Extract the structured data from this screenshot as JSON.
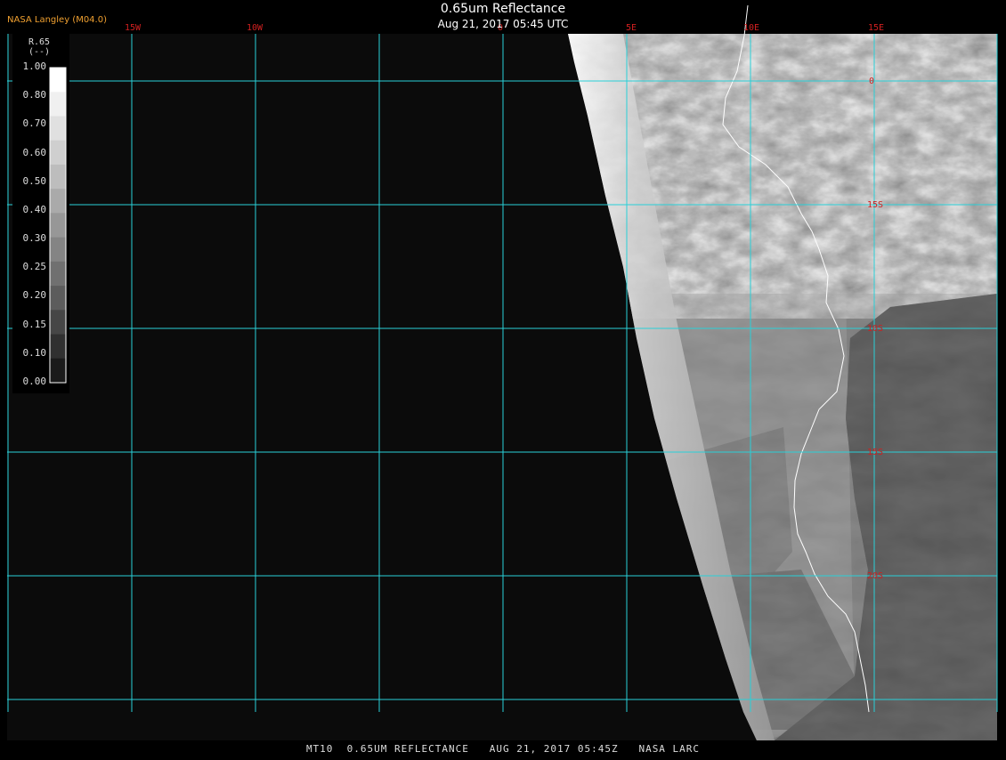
{
  "header": {
    "title": "0.65um Reflectance",
    "subtitle": "Aug 21, 2017 05:45 UTC",
    "agency": "NASA Langley (M04.0)"
  },
  "legend": {
    "title_lines": [
      "R.65",
      "(--)"
    ],
    "ticks": [
      "1.00",
      "0.80",
      "0.70",
      "0.60",
      "0.50",
      "0.40",
      "0.30",
      "0.25",
      "0.20",
      "0.15",
      "0.10",
      "0.00"
    ],
    "gray_levels": [
      "#ffffff",
      "#f0f0f0",
      "#e0e0e0",
      "#cfcfcf",
      "#bdbdbd",
      "#aaaaaa",
      "#979797",
      "#848484",
      "#707070",
      "#5c5c5c",
      "#464646",
      "#303030",
      "#1a1a1a"
    ]
  },
  "grid": {
    "longitude_labels": [
      "15W",
      "10W",
      "0",
      "5E",
      "10E",
      "15E"
    ],
    "latitude_labels": [
      "0",
      "15S",
      "10S",
      "15S",
      "20S"
    ],
    "line_color": "#29d0d8",
    "label_color": "#d02020"
  },
  "footer": "MT10  0.65UM REFLECTANCE   AUG 21, 2017 05:45Z   NASA LARC",
  "colors": {
    "background": "#0a0a0a",
    "space": "#000000"
  }
}
